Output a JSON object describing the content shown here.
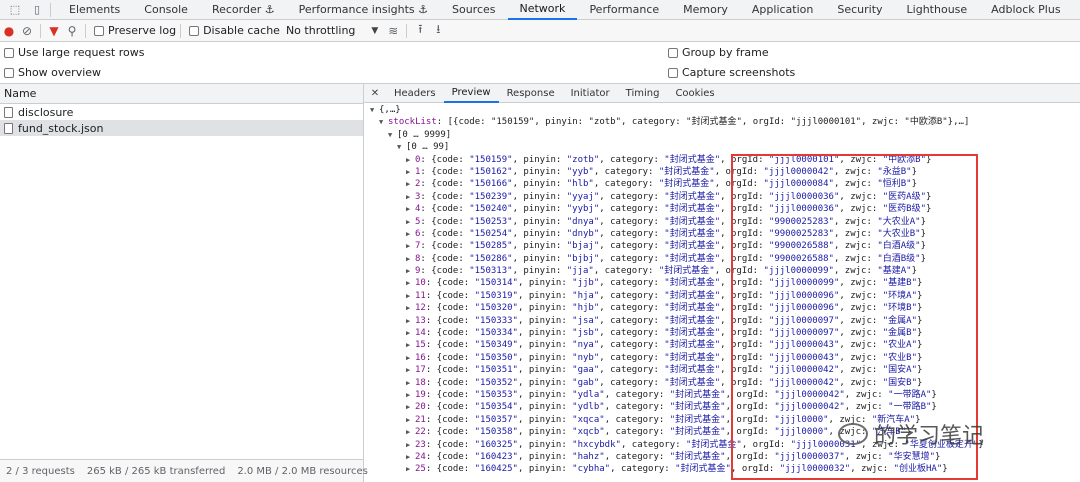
{
  "top_tabs": [
    "Elements",
    "Console",
    "Recorder ⚓",
    "Performance insights ⚓",
    "Sources",
    "Network",
    "Performance",
    "Memory",
    "Application",
    "Security",
    "Lighthouse",
    "Adblock Plus"
  ],
  "active_top_tab": "Network",
  "toolbar": {
    "preserve_log": "Preserve log",
    "disable_cache": "Disable cache",
    "throttling": "No throttling"
  },
  "settings": {
    "large_rows": "Use large request rows",
    "group_by_frame": "Group by frame",
    "show_overview": "Show overview",
    "capture_screenshots": "Capture screenshots"
  },
  "requests": {
    "header": "Name",
    "items": [
      "disclosure",
      "fund_stock.json"
    ],
    "selected": "fund_stock.json"
  },
  "status": {
    "requests": "2 / 3 requests",
    "transferred": "265 kB / 265 kB transferred",
    "resources": "2.0 MB / 2.0 MB resources"
  },
  "detail_tabs": [
    "Headers",
    "Preview",
    "Response",
    "Initiator",
    "Timing",
    "Cookies"
  ],
  "active_detail_tab": "Preview",
  "json_preview": {
    "root": "{,…}",
    "stocklist_key": "stockList",
    "stocklist_summary": "[{code: \"150159\", pinyin: \"zotb\", category: \"封闭式基金\", orgId: \"jjjl0000101\", zwjc: \"中欧添B\"},…]",
    "range_outer": "[0 … 9999]",
    "range_inner": "[0 … 99]",
    "rows": [
      {
        "i": "0",
        "code": "150159",
        "pinyin": "zotb",
        "category": "封闭式基金",
        "orgId": "jjjl0000101",
        "zwjc": "中欧添B"
      },
      {
        "i": "1",
        "code": "150162",
        "pinyin": "yyb",
        "category": "封闭式基金",
        "orgId": "jjjl0000042",
        "zwjc": "永益B"
      },
      {
        "i": "2",
        "code": "150166",
        "pinyin": "hlb",
        "category": "封闭式基金",
        "orgId": "jjjl0000084",
        "zwjc": "恒利B"
      },
      {
        "i": "3",
        "code": "150239",
        "pinyin": "yyaj",
        "category": "封闭式基金",
        "orgId": "jjjl0000036",
        "zwjc": "医药A级"
      },
      {
        "i": "4",
        "code": "150240",
        "pinyin": "yybj",
        "category": "封闭式基金",
        "orgId": "jjjl0000036",
        "zwjc": "医药B级"
      },
      {
        "i": "5",
        "code": "150253",
        "pinyin": "dnya",
        "category": "封闭式基金",
        "orgId": "9900025283",
        "zwjc": "大农业A"
      },
      {
        "i": "6",
        "code": "150254",
        "pinyin": "dnyb",
        "category": "封闭式基金",
        "orgId": "9900025283",
        "zwjc": "大农业B"
      },
      {
        "i": "7",
        "code": "150285",
        "pinyin": "bjaj",
        "category": "封闭式基金",
        "orgId": "9900026588",
        "zwjc": "白酒A级"
      },
      {
        "i": "8",
        "code": "150286",
        "pinyin": "bjbj",
        "category": "封闭式基金",
        "orgId": "9900026588",
        "zwjc": "白酒B级"
      },
      {
        "i": "9",
        "code": "150313",
        "pinyin": "jja",
        "category": "封闭式基金",
        "orgId": "jjjl0000099",
        "zwjc": "基建A"
      },
      {
        "i": "10",
        "code": "150314",
        "pinyin": "jjb",
        "category": "封闭式基金",
        "orgId": "jjjl0000099",
        "zwjc": "基建B"
      },
      {
        "i": "11",
        "code": "150319",
        "pinyin": "hja",
        "category": "封闭式基金",
        "orgId": "jjjl0000096",
        "zwjc": "环境A"
      },
      {
        "i": "12",
        "code": "150320",
        "pinyin": "hjb",
        "category": "封闭式基金",
        "orgId": "jjjl0000096",
        "zwjc": "环境B"
      },
      {
        "i": "13",
        "code": "150333",
        "pinyin": "jsa",
        "category": "封闭式基金",
        "orgId": "jjjl0000097",
        "zwjc": "金属A"
      },
      {
        "i": "14",
        "code": "150334",
        "pinyin": "jsb",
        "category": "封闭式基金",
        "orgId": "jjjl0000097",
        "zwjc": "金属B"
      },
      {
        "i": "15",
        "code": "150349",
        "pinyin": "nya",
        "category": "封闭式基金",
        "orgId": "jjjl0000043",
        "zwjc": "农业A"
      },
      {
        "i": "16",
        "code": "150350",
        "pinyin": "nyb",
        "category": "封闭式基金",
        "orgId": "jjjl0000043",
        "zwjc": "农业B"
      },
      {
        "i": "17",
        "code": "150351",
        "pinyin": "gaa",
        "category": "封闭式基金",
        "orgId": "jjjl0000042",
        "zwjc": "国安A"
      },
      {
        "i": "18",
        "code": "150352",
        "pinyin": "gab",
        "category": "封闭式基金",
        "orgId": "jjjl0000042",
        "zwjc": "国安B"
      },
      {
        "i": "19",
        "code": "150353",
        "pinyin": "ydla",
        "category": "封闭式基金",
        "orgId": "jjjl0000042",
        "zwjc": "一带路A"
      },
      {
        "i": "20",
        "code": "150354",
        "pinyin": "ydlb",
        "category": "封闭式基金",
        "orgId": "jjjl0000042",
        "zwjc": "一带路B"
      },
      {
        "i": "21",
        "code": "150357",
        "pinyin": "xqca",
        "category": "封闭式基金",
        "orgId": "jjjl0000",
        "zwjc": "新汽车A"
      },
      {
        "i": "22",
        "code": "150358",
        "pinyin": "xqcb",
        "category": "封闭式基金",
        "orgId": "jjjl0000",
        "zwjc": "汽车B"
      },
      {
        "i": "23",
        "code": "160325",
        "pinyin": "hxcybdk",
        "category": "封闭式基金",
        "orgId": "jjjl0000031",
        "zwjc": "华夏创业板定开"
      },
      {
        "i": "24",
        "code": "160423",
        "pinyin": "hahz",
        "category": "封闭式基金",
        "orgId": "jjjl0000037",
        "zwjc": "华安慧增"
      },
      {
        "i": "25",
        "code": "160425",
        "pinyin": "cybha",
        "category": "封闭式基金",
        "orgId": "jjjl0000032",
        "zwjc": "创业板HA"
      }
    ]
  },
  "watermark": "的学习笔记"
}
